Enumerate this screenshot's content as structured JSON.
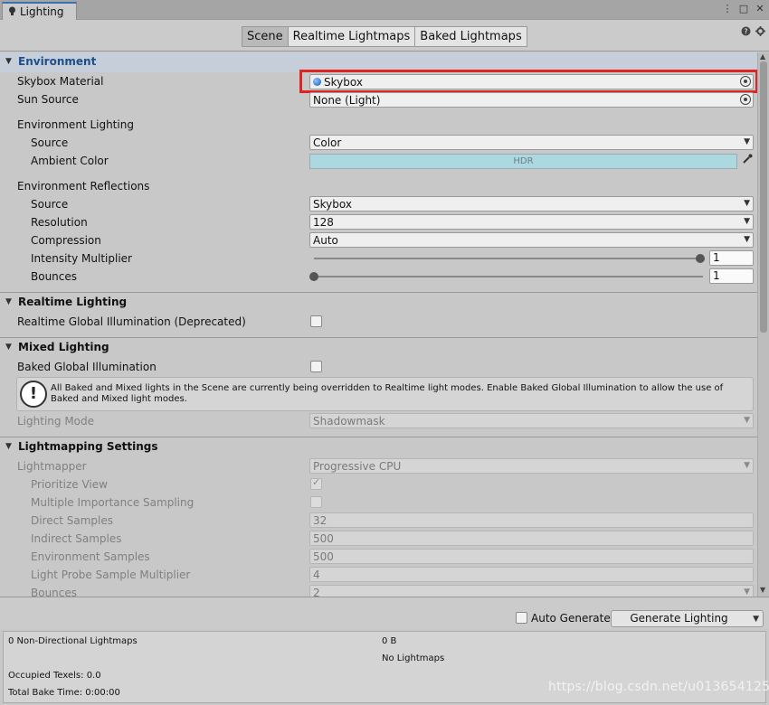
{
  "window": {
    "tab_title": "Lighting",
    "controls": [
      "⋮",
      "□",
      "✕"
    ]
  },
  "modes": [
    {
      "label": "Scene",
      "active": true
    },
    {
      "label": "Realtime Lightmaps",
      "active": false
    },
    {
      "label": "Baked Lightmaps",
      "active": false
    }
  ],
  "top_icons": [
    "help-icon",
    "settings-icon"
  ],
  "environment": {
    "title": "Environment",
    "skybox_material": {
      "label": "Skybox Material",
      "value": "Skybox"
    },
    "sun_source": {
      "label": "Sun Source",
      "value": "None (Light)"
    },
    "env_lighting": {
      "label": "Environment Lighting",
      "source_label": "Source",
      "source_value": "Color",
      "ambient_label": "Ambient Color",
      "ambient_hdr": "HDR",
      "ambient_color": "#acd8e0"
    },
    "env_reflections": {
      "label": "Environment Reflections",
      "source_label": "Source",
      "source_value": "Skybox",
      "resolution_label": "Resolution",
      "resolution_value": "128",
      "compression_label": "Compression",
      "compression_value": "Auto",
      "intensity_label": "Intensity Multiplier",
      "intensity_value": "1",
      "bounces_label": "Bounces",
      "bounces_value": "1"
    }
  },
  "realtime": {
    "title": "Realtime Lighting",
    "gi_label": "Realtime Global Illumination (Deprecated)",
    "gi_checked": false
  },
  "mixed": {
    "title": "Mixed Lighting",
    "baked_gi_label": "Baked Global Illumination",
    "baked_gi_checked": false,
    "info": "All Baked and Mixed lights in the Scene are currently being overridden to Realtime light modes. Enable Baked Global Illumination to allow the use of Baked and Mixed light modes.",
    "mode_label": "Lighting Mode",
    "mode_value": "Shadowmask"
  },
  "lightmapping": {
    "title": "Lightmapping Settings",
    "lightmapper_label": "Lightmapper",
    "lightmapper_value": "Progressive CPU",
    "prioritize_label": "Prioritize View",
    "prioritize_checked": true,
    "mis_label": "Multiple Importance Sampling",
    "mis_checked": false,
    "direct_label": "Direct Samples",
    "direct_value": "32",
    "indirect_label": "Indirect Samples",
    "indirect_value": "500",
    "env_samples_label": "Environment Samples",
    "env_samples_value": "500",
    "probe_label": "Light Probe Sample Multiplier",
    "probe_value": "4",
    "bounces_label": "Bounces",
    "bounces_value": "2"
  },
  "bottom": {
    "auto_generate_label": "Auto Generate",
    "auto_generate_checked": false,
    "generate_label": "Generate Lighting"
  },
  "stats": {
    "lightmaps": "0 Non-Directional Lightmaps",
    "size": "0 B",
    "no_lightmaps": "No Lightmaps",
    "occupied": "Occupied Texels: 0.0",
    "bake_time": "Total Bake Time: 0:00:00"
  },
  "watermark": "https://blog.csdn.net/u013654125"
}
